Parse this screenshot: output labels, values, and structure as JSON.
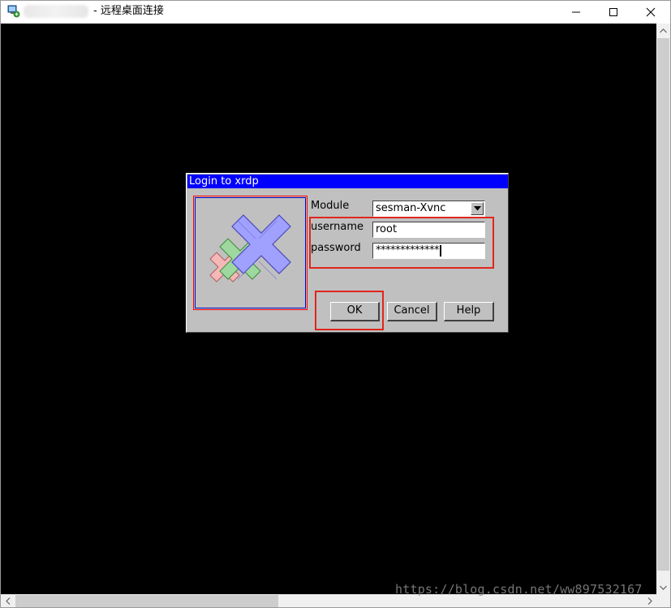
{
  "window": {
    "title": "- 远程桌面连接",
    "minimize_icon": "minimize-icon",
    "maximize_icon": "maximize-icon",
    "close_icon": "close-icon"
  },
  "dialog": {
    "title": "Login to xrdp",
    "module_label": "Module",
    "module_value": "sesman-Xvnc",
    "username_label": "username",
    "username_value": "root",
    "password_label": "password",
    "password_value": "*************",
    "ok_label": "OK",
    "cancel_label": "Cancel",
    "help_label": "Help",
    "logo_icon": "xrdp-logo-icon"
  },
  "watermark": "https://blog.csdn.net/ww897532167",
  "colors": {
    "dialog_bg": "#c0c0c0",
    "title_bar": "#0000ff",
    "annotation": "#e0261e",
    "remote_bg": "#000000"
  }
}
